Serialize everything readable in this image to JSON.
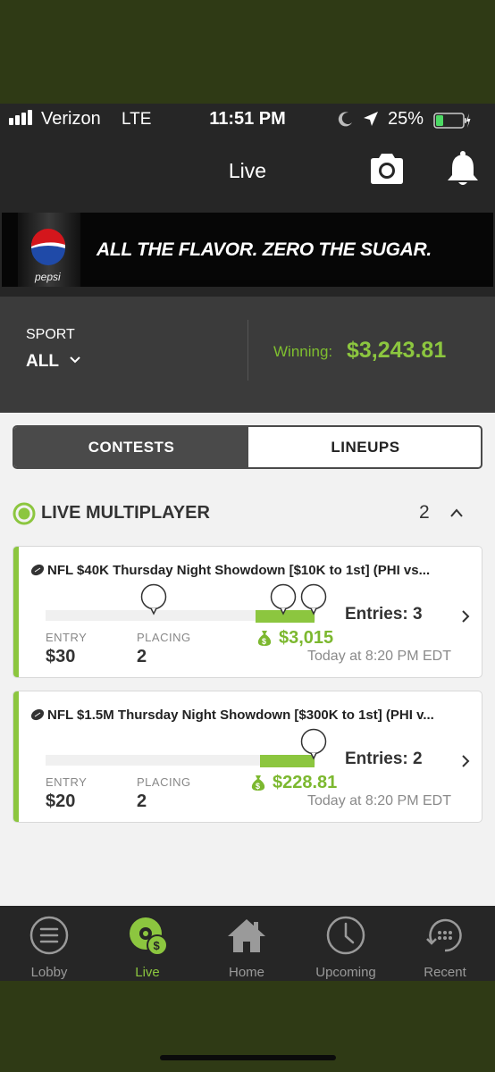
{
  "status_bar": {
    "carrier": "Verizon",
    "network": "LTE",
    "time": "11:51 PM",
    "battery": "25%"
  },
  "header": {
    "title": "Live",
    "camera_icon": "camera-icon",
    "bell_icon": "bell-icon"
  },
  "ad": {
    "brand": "pepsi",
    "text": "ALL THE FLAVOR. ZERO THE SUGAR."
  },
  "sport_panel": {
    "label": "SPORT",
    "value": "ALL",
    "winning_label": "Winning:",
    "winning_value": "$3,243.81"
  },
  "tabs": {
    "contests": "CONTESTS",
    "lineups": "LINEUPS",
    "selected": "CONTESTS"
  },
  "section": {
    "title": "LIVE MULTIPLAYER",
    "count": "2"
  },
  "contests": [
    {
      "title": "NFL $40K Thursday Night Showdown [$10K to 1st] (PHI vs...",
      "entries": "Entries: 3",
      "entry_label": "ENTRY",
      "entry_value": "$30",
      "placing_label": "PLACING",
      "placing_value": "2",
      "winnings": "$3,015",
      "start_time": "Today at 8:20 PM EDT"
    },
    {
      "title": "NFL $1.5M Thursday Night Showdown [$300K to 1st] (PHI v...",
      "entries": "Entries: 2",
      "entry_label": "ENTRY",
      "entry_value": "$20",
      "placing_label": "PLACING",
      "placing_value": "2",
      "winnings": "$228.81",
      "start_time": "Today at 8:20 PM EDT"
    }
  ],
  "tab_bar": [
    {
      "label": "Lobby",
      "icon": "lobby-icon",
      "active": false
    },
    {
      "label": "Live",
      "icon": "live-icon",
      "active": true
    },
    {
      "label": "Home",
      "icon": "home-icon",
      "active": false
    },
    {
      "label": "Upcoming",
      "icon": "clock-icon",
      "active": false
    },
    {
      "label": "Recent",
      "icon": "recent-icon",
      "active": false
    }
  ],
  "colors": {
    "accent": "#8cc63f",
    "header_bg": "#262626",
    "panel_bg": "#3b3b3b",
    "content_bg": "#f2f2f2",
    "frame": "#2f3a15"
  }
}
